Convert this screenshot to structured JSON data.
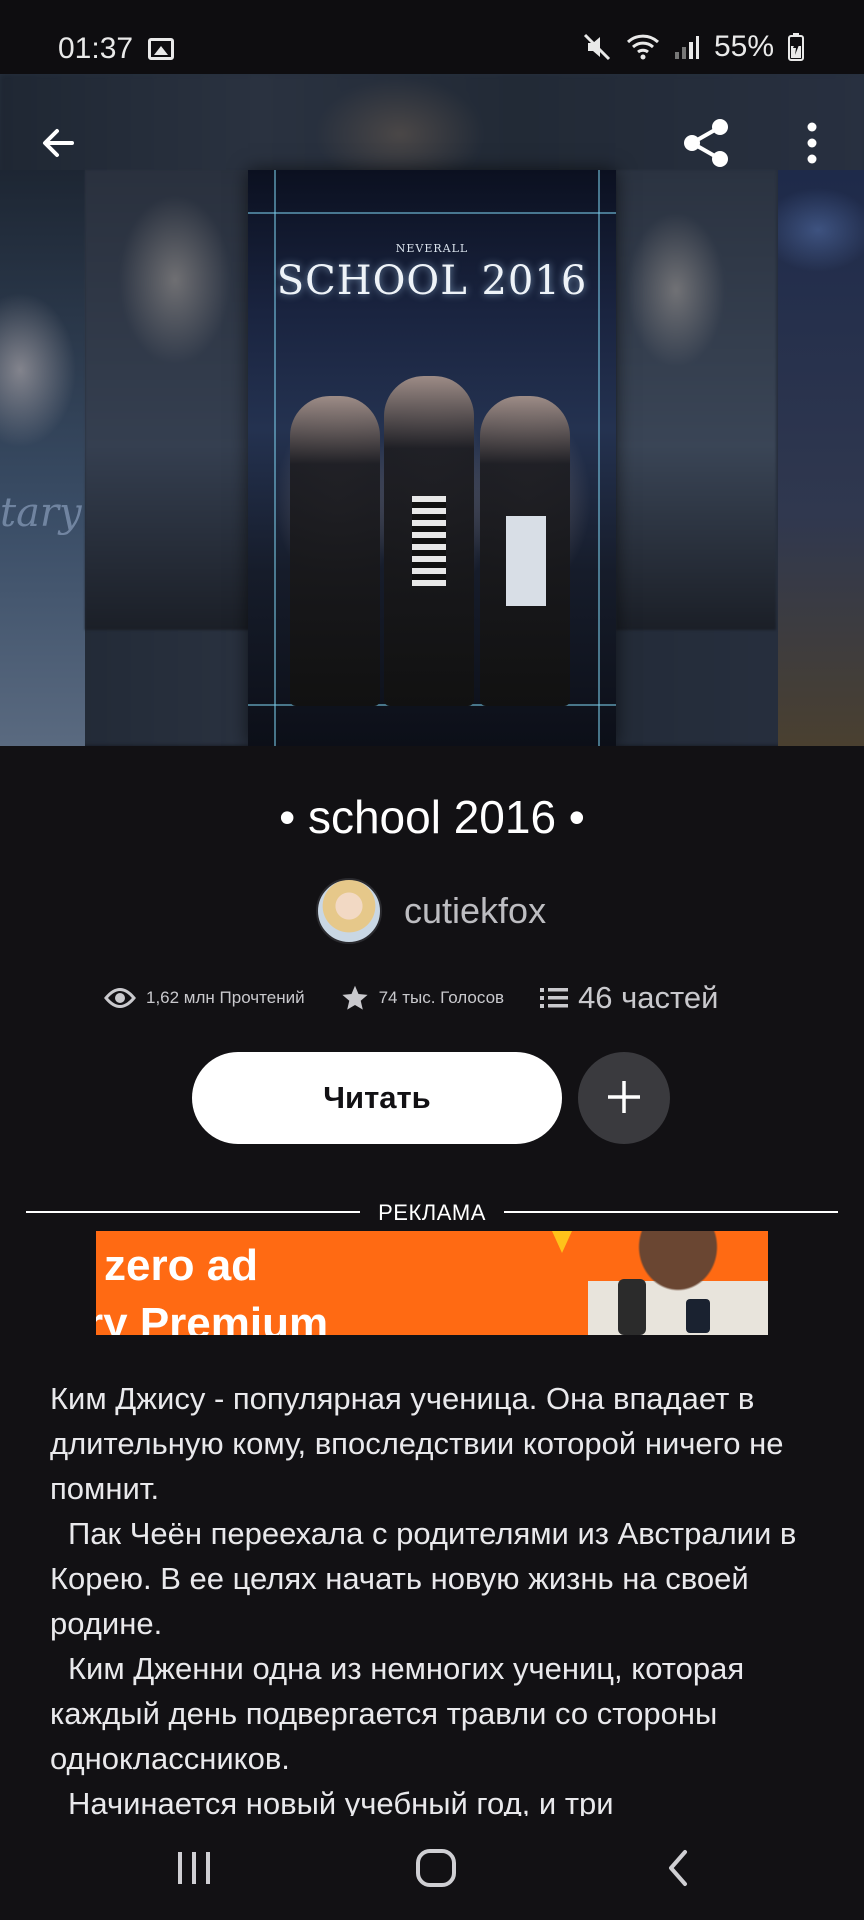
{
  "status_bar": {
    "time": "01:37",
    "battery": "55%",
    "icons": [
      "image-icon",
      "mute-icon",
      "wifi-icon",
      "signal-icon",
      "battery-icon"
    ]
  },
  "header": {
    "back_icon": "arrow-left-icon",
    "share_icon": "share-icon",
    "more_icon": "more-vertical-icon"
  },
  "cover": {
    "publisher": "NEVERALL",
    "title_art": "SCHOOL 2016"
  },
  "side_cover_text": "tary",
  "story": {
    "title": "• school 2016 •",
    "author": "cutiekfox"
  },
  "stats": {
    "reads": "1,62 млн Прочтений",
    "votes": "74 тыс. Голосов",
    "parts": "46 частей"
  },
  "actions": {
    "read_label": "Читать",
    "add_icon": "plus-icon"
  },
  "ad": {
    "label": "РЕКЛАМА",
    "line1": "zero ad",
    "line2": "ry Premium"
  },
  "description": [
    "Ким Джису - популярная ученица. Она впадает в длительную кому, впоследствии которой ничего не помнит.",
    "Пак Чеён переехала с родителями из Австралии в Корею. В ее целях начать новую жизнь на своей родине.",
    "Ким Дженни одна из немногих учениц, которая каждый день подвергается травли со стороны одноклассников.",
    "Начинается новый учебный год, и три"
  ],
  "colors": {
    "background": "#121114",
    "ad_orange": "#ff6a13",
    "button_white": "#ffffff",
    "add_button": "#3a3a3e"
  }
}
